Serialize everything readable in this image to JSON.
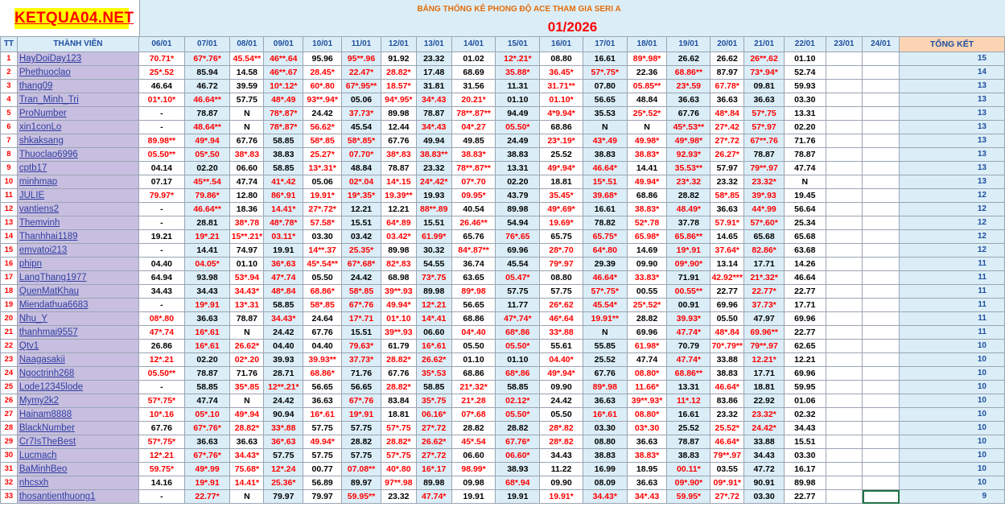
{
  "logo_text": "KETQUA04.NET",
  "banner_title": "BẢNG THỐNG KÊ PHONG ĐỘ ACE THAM GIA SERI A",
  "month_title": "01/2026",
  "headers": {
    "tt": "TT",
    "member": "THÀNH VIÊN",
    "total": "TỔNG KẾT",
    "dates": [
      "06/01",
      "07/01",
      "08/01",
      "09/01",
      "10/01",
      "11/01",
      "12/01",
      "13/01",
      "14/01",
      "15/01",
      "16/01",
      "17/01",
      "18/01",
      "19/01",
      "20/01",
      "21/01",
      "22/01",
      "23/01",
      "24/01"
    ]
  },
  "colors": {
    "header_bg": "#dbeef7",
    "name_bg": "#c8bfe0",
    "red": "#ff0000",
    "logo_bg": "#ffff00",
    "total_header_bg": "#fbd4b4"
  },
  "rows": [
    {
      "tt": "1",
      "name": "HayDoiDay123",
      "vals": [
        "70.71*",
        "67*.76*",
        "45.54**",
        "46**.64",
        "95.96",
        "95**.96",
        "91.92",
        "23.32",
        "01.02",
        "12*.21*",
        "08.80",
        "16.61",
        "89*.98*",
        "26.62",
        "26.62",
        "26**.62",
        "01.10",
        "",
        ""
      ],
      "total": "15"
    },
    {
      "tt": "2",
      "name": "Phethuoclao",
      "vals": [
        "25*.52",
        "85.94",
        "14.58",
        "46**.67",
        "28.45*",
        "22.47*",
        "28.82*",
        "17.48",
        "68.69",
        "35.88*",
        "36.45*",
        "57*.75*",
        "22.36",
        "68.86**",
        "87.97",
        "73*.94*",
        "52.74",
        "",
        ""
      ],
      "total": "14"
    },
    {
      "tt": "3",
      "name": "thang09",
      "vals": [
        "46.64",
        "46.72",
        "39.59",
        "10*.12*",
        "60*.80",
        "67*.95**",
        "18.57*",
        "31.81",
        "31.56",
        "11.31",
        "31.71**",
        "07.80",
        "05.85**",
        "23*.59",
        "67.78*",
        "09.81",
        "59.93",
        "",
        ""
      ],
      "total": "13"
    },
    {
      "tt": "4",
      "name": "Tran_Minh_Tri",
      "vals": [
        "01*.10*",
        "46.64**",
        "57.75",
        "48*.49",
        "93**.94*",
        "05.06",
        "94*.95*",
        "34*.43",
        "20.21*",
        "01.10",
        "01.10*",
        "56.65",
        "48.84",
        "36.63",
        "36.63",
        "36.63",
        "03.30",
        "",
        ""
      ],
      "total": "13"
    },
    {
      "tt": "5",
      "name": "ProNumber",
      "vals": [
        "-",
        "78.87",
        "N",
        "78*.87*",
        "24.42",
        "37.73*",
        "89.98",
        "78.87",
        "78**.87**",
        "94.49",
        "4*9.94*",
        "35.53",
        "25*.52*",
        "67.76",
        "48*.84",
        "57*.75",
        "13.31",
        "",
        ""
      ],
      "total": "13"
    },
    {
      "tt": "6",
      "name": "xin1conLo",
      "vals": [
        "-",
        "48.64**",
        "N",
        "78*.87*",
        "56.62*",
        "45.54",
        "12.44",
        "34*.43",
        "04*.27",
        "05.50*",
        "68.86",
        "N",
        "N",
        "45*.53**",
        "27*.42",
        "57*.97",
        "02.20",
        "",
        ""
      ],
      "total": "13"
    },
    {
      "tt": "7",
      "name": "shkaksang",
      "vals": [
        "89.98**",
        "49*.94",
        "67.76",
        "58.85",
        "58*.85",
        "58*.85*",
        "67.76",
        "49.94",
        "49.85",
        "24.49",
        "23*.19*",
        "43*.49",
        "49.98*",
        "49*.98*",
        "27*.72",
        "67**.76",
        "71.76",
        "",
        ""
      ],
      "total": "13"
    },
    {
      "tt": "8",
      "name": "Thuoclao6996",
      "vals": [
        "05.50**",
        "05*.50",
        "38*.83",
        "38.83",
        "25.27*",
        "07.70*",
        "38*.83",
        "38.83**",
        "38.83*",
        "38.83",
        "25.52",
        "38.83",
        "38.83*",
        "92.93*",
        "26.27*",
        "78.87",
        "78.87",
        "",
        ""
      ],
      "total": "13"
    },
    {
      "tt": "9",
      "name": "cptb17",
      "vals": [
        "04.14",
        "02.20",
        "06.60",
        "58.85",
        "13*.31*",
        "48.84",
        "78.87",
        "23.32",
        "78**.87**",
        "13.31",
        "49*.94*",
        "46.64*",
        "14.41",
        "35.53**",
        "57.97",
        "79**.97",
        "47.74",
        "",
        ""
      ],
      "total": "13"
    },
    {
      "tt": "10",
      "name": "minhmap",
      "vals": [
        "07.17",
        "45**.54",
        "47.74",
        "41*.42",
        "05.06",
        "02*.04",
        "14*.15",
        "24*.42*",
        "07*.70",
        "02.20",
        "18.81",
        "15*.51",
        "49.94*",
        "23*.32",
        "23.32",
        "23.32*",
        "N",
        "",
        ""
      ],
      "total": "13"
    },
    {
      "tt": "11",
      "name": "JULIE",
      "vals": [
        "79.97*",
        "79.86*",
        "12.80",
        "86*.91",
        "19.91*",
        "19*.35*",
        "19.39**",
        "19.93",
        "09.95*",
        "43.79",
        "35.45*",
        "39.68*",
        "68.86",
        "28.82",
        "58*.85",
        "39*.93",
        "19.45",
        "",
        ""
      ],
      "total": "12"
    },
    {
      "tt": "12",
      "name": "vantiens2",
      "vals": [
        "-",
        "46.64**",
        "18.36",
        "14.41*",
        "27*.72*",
        "12.21",
        "12.21",
        "88**.89",
        "40.54",
        "89.98",
        "49*.69*",
        "16.61",
        "38.83*",
        "48.49*",
        "36.63",
        "44*.99",
        "56.64",
        "",
        ""
      ],
      "total": "12"
    },
    {
      "tt": "13",
      "name": "Themvinh",
      "vals": [
        "-",
        "28.81",
        "38*.78",
        "48*.78*",
        "57.58*",
        "15.51",
        "64*.89",
        "15.51",
        "26.46**",
        "54.94",
        "19.69*",
        "78.82",
        "52*.78",
        "37.78",
        "57.91*",
        "57*.60*",
        "25.34",
        "",
        ""
      ],
      "total": "12"
    },
    {
      "tt": "14",
      "name": "Thanhhai1189",
      "vals": [
        "19.21",
        "19*.21",
        "15**.21*",
        "03.11*",
        "03.30",
        "03.42",
        "03.42*",
        "61.99*",
        "65.76",
        "76*.65",
        "65.75",
        "65.75*",
        "65.98*",
        "65.86**",
        "14.65",
        "65.68",
        "65.68",
        "",
        ""
      ],
      "total": "12"
    },
    {
      "tt": "15",
      "name": "emvatoi213",
      "vals": [
        "-",
        "14.41",
        "74.97",
        "19.91",
        "14**.37",
        "25.35*",
        "89.98",
        "30.32",
        "84*.87**",
        "69.96",
        "28*.70",
        "64*.80",
        "14.69",
        "19*.91",
        "37.64*",
        "82.86*",
        "63.68",
        "",
        ""
      ],
      "total": "12"
    },
    {
      "tt": "16",
      "name": "phipn",
      "vals": [
        "04.40",
        "04.05*",
        "01.10",
        "36*.63",
        "45*.54**",
        "67*.68*",
        "82*.83",
        "54.55",
        "36.74",
        "45.54",
        "79*.97",
        "29.39",
        "09.90",
        "09*.90*",
        "13.14",
        "17.71",
        "14.26",
        "",
        ""
      ],
      "total": "11"
    },
    {
      "tt": "17",
      "name": "LangThang1977",
      "vals": [
        "64.94",
        "93.98",
        "53*.94",
        "47*.74",
        "05.50",
        "24.42",
        "68.98",
        "73*.75",
        "63.65",
        "05.47*",
        "08.80",
        "46.64*",
        "33.83*",
        "71.91",
        "42.92***",
        "21*.32*",
        "46.64",
        "",
        ""
      ],
      "total": "11"
    },
    {
      "tt": "18",
      "name": "QuenMatKhau",
      "vals": [
        "34.43",
        "34.43",
        "34.43*",
        "48*.84",
        "68.86*",
        "58*.85",
        "39**.93",
        "89.98",
        "89*.98",
        "57.75",
        "57.75",
        "57*.75*",
        "00.55",
        "00.55**",
        "22.77",
        "22.77*",
        "22.77",
        "",
        ""
      ],
      "total": "11"
    },
    {
      "tt": "19",
      "name": "Miendathua6683",
      "vals": [
        "-",
        "19*.91",
        "13*.31",
        "58.85",
        "58*.85",
        "67*.76",
        "49.94*",
        "12*.21",
        "56.65",
        "11.77",
        "26*.62",
        "45.54*",
        "25*.52*",
        "00.91",
        "69.96",
        "37.73*",
        "17.71",
        "",
        ""
      ],
      "total": "11"
    },
    {
      "tt": "20",
      "name": "Nhu_Y",
      "vals": [
        "08*.80",
        "36.63",
        "78.87",
        "34.43*",
        "24.64",
        "17*.71",
        "01*.10",
        "14*.41",
        "68.86",
        "47*.74*",
        "46*.64",
        "19.91**",
        "28.82",
        "39.93*",
        "05.50",
        "47.97",
        "69.96",
        "",
        ""
      ],
      "total": "11"
    },
    {
      "tt": "21",
      "name": "thanhmai9557",
      "vals": [
        "47*.74",
        "16*.61",
        "N",
        "24.42",
        "67.76",
        "15.51",
        "39**.93",
        "06.60",
        "04*.40",
        "68*.86",
        "33*.88",
        "N",
        "69.96",
        "47.74*",
        "48*.84",
        "69.96**",
        "22.77",
        "",
        ""
      ],
      "total": "11"
    },
    {
      "tt": "22",
      "name": "Qtv1",
      "vals": [
        "26.86",
        "16*.61",
        "26.62*",
        "04.40",
        "04.40",
        "79.63*",
        "61.79",
        "16*.61",
        "05.50",
        "05.50*",
        "55.61",
        "55.85",
        "61.98*",
        "70.79",
        "70*.79**",
        "79**.97",
        "62.65",
        "",
        ""
      ],
      "total": "10"
    },
    {
      "tt": "23",
      "name": "Naagasakii",
      "vals": [
        "12*.21",
        "02.20",
        "02*.20",
        "39.93",
        "39.93**",
        "37.73*",
        "28.82*",
        "26.62*",
        "01.10",
        "01.10",
        "04.40*",
        "25.52",
        "47.74",
        "47.74*",
        "33.88",
        "12.21*",
        "12.21",
        "",
        ""
      ],
      "total": "10"
    },
    {
      "tt": "24",
      "name": "Ngoctrinh268",
      "vals": [
        "05.50**",
        "78.87",
        "71.76",
        "28.71",
        "68.86*",
        "71.76",
        "67.76",
        "35*.53",
        "68.86",
        "68*.86",
        "49*.94*",
        "67.76",
        "08.80*",
        "68.86**",
        "38.83",
        "17.71",
        "69.96",
        "",
        ""
      ],
      "total": "10"
    },
    {
      "tt": "25",
      "name": "Lode12345lode",
      "vals": [
        "-",
        "58.85",
        "35*.85",
        "12**.21*",
        "56.65",
        "56.65",
        "28.82*",
        "58.85",
        "21*.32*",
        "58.85",
        "09.90",
        "89*.98",
        "11.66*",
        "13.31",
        "46.64*",
        "18.81",
        "59.95",
        "",
        ""
      ],
      "total": "10"
    },
    {
      "tt": "26",
      "name": "Mymy2k2",
      "vals": [
        "57*.75*",
        "47.74",
        "N",
        "24.42",
        "36.63",
        "67*.76",
        "83.84",
        "35*.75",
        "21*.28",
        "02.12*",
        "24.42",
        "36.63",
        "39**.93*",
        "11*.12",
        "83.86",
        "22.92",
        "01.06",
        "",
        ""
      ],
      "total": "10"
    },
    {
      "tt": "27",
      "name": "Hainam8888",
      "vals": [
        "10*.16",
        "05*.10",
        "49*.94",
        "90.94",
        "16*.61",
        "19*.91",
        "18.81",
        "06.16*",
        "07*.68",
        "05.50*",
        "05.50",
        "16*.61",
        "08.80*",
        "16.61",
        "23.32",
        "23.32*",
        "02.32",
        "",
        ""
      ],
      "total": "10"
    },
    {
      "tt": "28",
      "name": "BlackNumber",
      "vals": [
        "67.76",
        "67*.76*",
        "28.82*",
        "33*.88",
        "57.75",
        "57.75",
        "57*.75",
        "27*.72",
        "28.82",
        "28.82",
        "28*.82",
        "03.30",
        "03*.30",
        "25.52",
        "25.52*",
        "24.42*",
        "34.43",
        "",
        ""
      ],
      "total": "10"
    },
    {
      "tt": "29",
      "name": "Cr7IsTheBest",
      "vals": [
        "57*.75*",
        "36.63",
        "36.63",
        "36*.63",
        "49.94*",
        "28.82",
        "28.82*",
        "26.62*",
        "45*.54",
        "67.76*",
        "28*.82",
        "08.80",
        "36.63",
        "78.87",
        "46.64*",
        "33.88",
        "15.51",
        "",
        ""
      ],
      "total": "10"
    },
    {
      "tt": "30",
      "name": "Lucmach",
      "vals": [
        "12*.21",
        "67*.76*",
        "34.43*",
        "57.75",
        "57.75",
        "57.75",
        "57*.75",
        "27*.72",
        "06.60",
        "06.60*",
        "34.43",
        "38.83",
        "38.83*",
        "38.83",
        "79**.97",
        "34.43",
        "03.30",
        "",
        ""
      ],
      "total": "10"
    },
    {
      "tt": "31",
      "name": "BaMinhBeo",
      "vals": [
        "59.75*",
        "49*.99",
        "75.68*",
        "12*.24",
        "00.77",
        "07.08**",
        "40*.80",
        "16*.17",
        "98.99*",
        "38.93",
        "11.22",
        "16.99",
        "18.95",
        "00.11*",
        "03.55",
        "47.72",
        "16.17",
        "",
        ""
      ],
      "total": "10"
    },
    {
      "tt": "32",
      "name": "nhcsxh",
      "vals": [
        "14.16",
        "19*.91",
        "14.41*",
        "25.36*",
        "56.89",
        "89.97",
        "97**.98",
        "89.98",
        "09.98",
        "68*.94",
        "09.90",
        "08.09",
        "36.63",
        "09*.90*",
        "09*.91*",
        "90.91",
        "89.98",
        "",
        ""
      ],
      "total": "10"
    },
    {
      "tt": "33",
      "name": "thosantienthuong1",
      "vals": [
        "-",
        "22.77*",
        "N",
        "79.97",
        "79.97",
        "59.95**",
        "23.32",
        "47.74*",
        "19.91",
        "19.91",
        "19.91*",
        "34.43*",
        "34*.43",
        "59.95*",
        "27*.72",
        "03.30",
        "22.77",
        "",
        ""
      ],
      "total": "9"
    }
  ]
}
